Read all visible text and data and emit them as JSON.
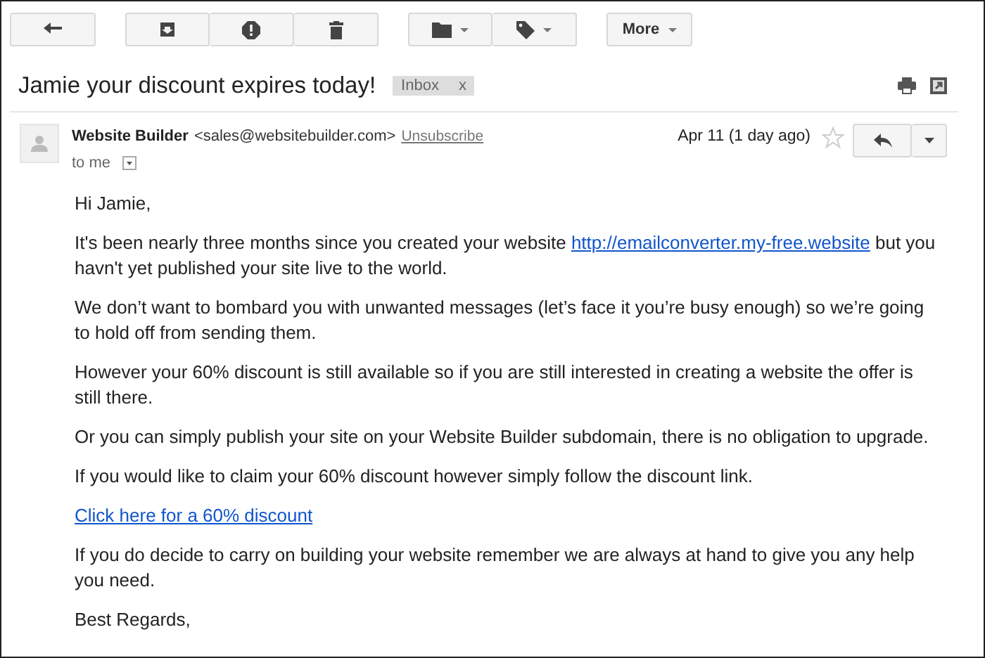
{
  "toolbar": {
    "more_label": "More"
  },
  "subject": "Jamie your discount expires today!",
  "label": {
    "text": "Inbox",
    "remove": "x"
  },
  "sender": {
    "name": "Website Builder",
    "email": "<sales@websitebuilder.com>",
    "unsubscribe": "Unsubscribe",
    "recipient": "to me",
    "date": "Apr 11 (1 day ago)",
    "starred": false
  },
  "body": [
    {
      "kind": "text",
      "text": "Hi Jamie,"
    },
    {
      "kind": "link_text",
      "before": "It's been nearly three months since you created your website ",
      "link": "http://emailconverter.my-free.website",
      "after": " but you havn't yet published your site live to the world."
    },
    {
      "kind": "text",
      "text": "We don’t want to bombard you with unwanted messages (let’s face it you’re busy enough) so we’re going to hold off from sending them."
    },
    {
      "kind": "text",
      "text": "However your 60% discount is still available so if you are still interested in creating a website the offer is still there."
    },
    {
      "kind": "text",
      "text": "Or you can simply publish your site on your Website Builder subdomain, there is no obligation to upgrade."
    },
    {
      "kind": "text",
      "text": "If you would like to claim your 60% discount however simply follow the discount link."
    },
    {
      "kind": "link",
      "text": "Click here for a 60% discount"
    },
    {
      "kind": "text",
      "text": "If you do decide to carry on building your website remember we are always at hand to give you any help you need."
    },
    {
      "kind": "text",
      "text": "Best Regards,"
    }
  ]
}
